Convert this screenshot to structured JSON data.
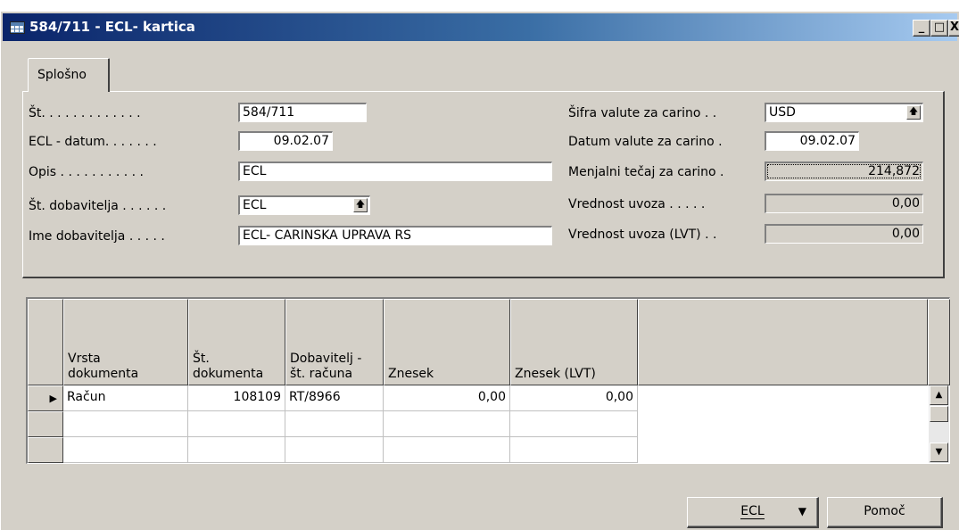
{
  "window": {
    "title": "584/711 - ECL- kartica",
    "minimize": "_",
    "maximize": "□",
    "close": "X"
  },
  "tabs": [
    {
      "label": "Splošno"
    }
  ],
  "left_fields": [
    {
      "label": "Št. . . . . . . . . . . . .",
      "value": "584/711"
    },
    {
      "label": "ECL - datum. . . . . . .",
      "value": "09.02.07"
    },
    {
      "label": "Opis . . . . . . . . . . .",
      "value": "ECL"
    },
    {
      "label": "Št. dobavitelja . . . . . .",
      "value": "ECL"
    },
    {
      "label": "Ime dobavitelja . . . . .",
      "value": "ECL- CARINSKA UPRAVA RS"
    }
  ],
  "right_fields": [
    {
      "label": "Šifra valute za carino . .",
      "value": "USD"
    },
    {
      "label": "Datum valute za carino .",
      "value": "09.02.07"
    },
    {
      "label": "Menjalni tečaj za carino .",
      "value": "214,872"
    },
    {
      "label": "Vrednost uvoza . . . . .",
      "value": "0,00"
    },
    {
      "label": "Vrednost uvoza (LVT) . .",
      "value": "0,00"
    }
  ],
  "grid": {
    "columns": [
      "Vrsta\ndokumenta",
      "Št.\ndokumenta",
      "Dobavitelj -\nšt. računa",
      "Znesek",
      "Znesek (LVT)"
    ],
    "rows": [
      {
        "vrsta": "Račun",
        "st": "108109",
        "dobavitelj": "RT/8966",
        "znesek": "0,00",
        "znesek_lvt": "0,00"
      }
    ],
    "current_row_marker": "▶"
  },
  "buttons": {
    "ecl": "ECL",
    "pomoc": "Pomoč"
  },
  "icons": {
    "lookup": "lookup-arrow-icon",
    "scroll_up": "▲",
    "scroll_down": "▼",
    "dropdown": "▼"
  }
}
